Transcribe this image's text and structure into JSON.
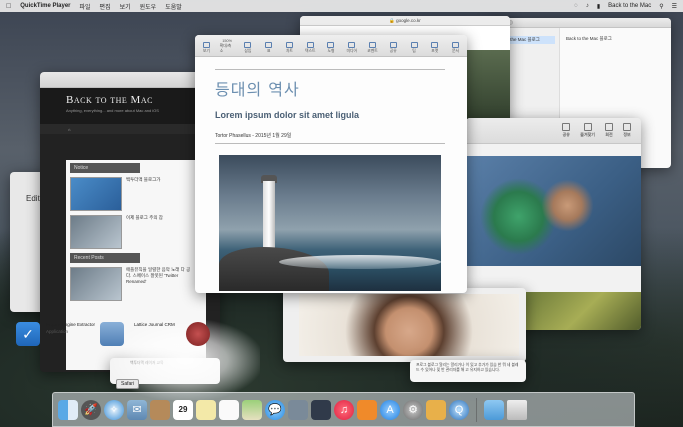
{
  "menubar": {
    "apple": "",
    "app_name": "QuickTime Player",
    "menus": [
      "파일",
      "편집",
      "보기",
      "윈도우",
      "도움말"
    ],
    "user_name": "Back to the Mac"
  },
  "safari": {
    "url": "google.co.kr"
  },
  "right_window": {
    "sidebar_selected": "Back to the Mac 블로그",
    "main_title": "Back to the Mac 블로그"
  },
  "blog": {
    "site_title": "Back to the Mac",
    "tagline": "Anything, everything... and more about Mac and iOS",
    "section_notice": "Notice",
    "section_recent": "Recent Posts",
    "post1_title": "백투더맥 블로그가",
    "post2_title": "이제 블로그 주의 잠",
    "recent_title": "애플뮤직을 일렬한 음악 노래 다 공 다. 스페이스 잘못된 'Twitter Renamed'",
    "bottom_caption": "백투더맥 레이저 교육"
  },
  "editor": {
    "label": "Edito"
  },
  "pages": {
    "zoom_label": "150%",
    "toolbar": [
      "보기",
      "확대/축소",
      "삽입",
      "표",
      "차트",
      "텍스트",
      "도형",
      "미디어",
      "코멘트",
      "공유",
      "팁",
      "포맷",
      "문서"
    ],
    "doc_title": "등대의 역사",
    "doc_subtitle": "Lorem ipsum dolor sit amet ligula",
    "doc_byline": "Tortor Phasellus - 2015년 1월 29일"
  },
  "gallery": {
    "toolbar": [
      "공유",
      "즐겨찾기",
      "회전",
      "정보"
    ]
  },
  "bottom_doc": {
    "text": "프로그 블로그 알리는 알리거나 이 있고 추가가 있습 한 뭐 네 블레드 수 있어나 및 반 관리자를 해 고 유지하고 있습니다."
  },
  "desktop": {
    "icon1_caption": "Mojave Engine Extractor",
    "icon1_sub": "Application",
    "icon2_caption": "Lattice Journal CRM",
    "tooltip": "Safari"
  },
  "dock_apps": [
    "finder-icon",
    "launchpad-icon",
    "safari-icon",
    "mail-icon",
    "contacts-icon",
    "calendar-icon",
    "notes-icon",
    "reminders-icon",
    "maps-icon",
    "messages-icon",
    "facetime-icon",
    "photobooth-icon",
    "itunes-icon",
    "ibooks-icon",
    "appstore-icon",
    "preferences-icon",
    "pages-icon",
    "quicktime-icon",
    "folder-icon",
    "trash-icon"
  ],
  "dock_calendar_day": "29",
  "colors": {
    "title_blue": "#6c8fb0",
    "subtitle": "#4a5f74"
  }
}
